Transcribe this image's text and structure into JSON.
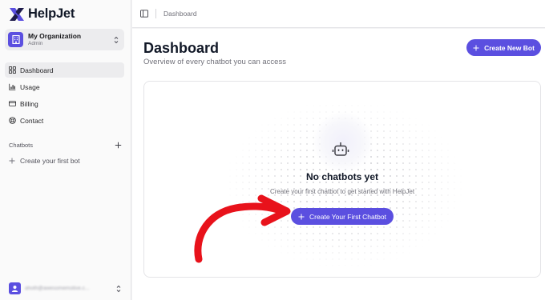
{
  "app": {
    "name": "HelpJet"
  },
  "org": {
    "name": "My Organization",
    "role": "Admin"
  },
  "nav": {
    "items": [
      {
        "label": "Dashboard",
        "icon": "grid-icon",
        "active": true
      },
      {
        "label": "Usage",
        "icon": "bar-chart-icon",
        "active": false
      },
      {
        "label": "Billing",
        "icon": "credit-card-icon",
        "active": false
      },
      {
        "label": "Contact",
        "icon": "lifebuoy-icon",
        "active": false
      }
    ]
  },
  "chatbots": {
    "label": "Chatbots",
    "create_link": "Create your first bot"
  },
  "user": {
    "email": "ahoth@awesomemotive.c..."
  },
  "topbar": {
    "breadcrumb": "Dashboard"
  },
  "page": {
    "title": "Dashboard",
    "subtitle": "Overview of every chatbot you can access",
    "create_button": "Create New Bot"
  },
  "empty_state": {
    "title": "No chatbots yet",
    "description": "Create your first chatbot to get started with HelpJet",
    "button": "Create Your First Chatbot"
  },
  "colors": {
    "accent": "#5b4fe0",
    "annotation": "#e8121b"
  }
}
